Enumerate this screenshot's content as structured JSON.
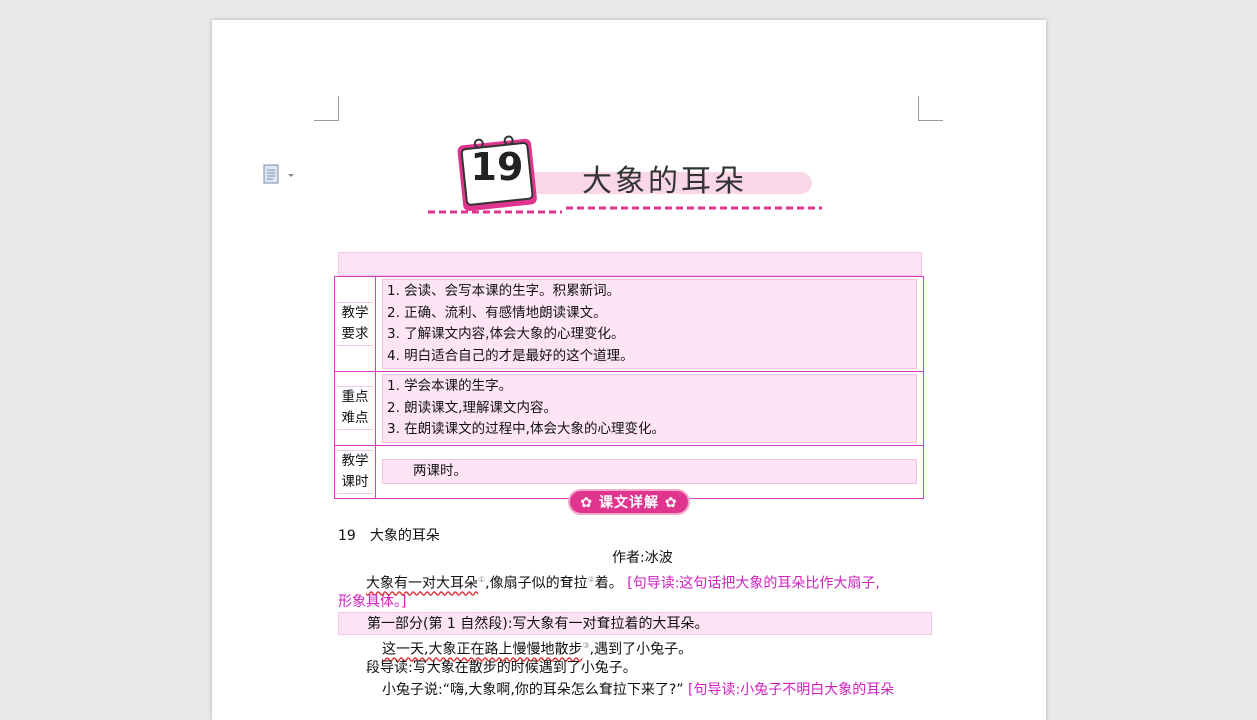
{
  "lesson": {
    "number": "19",
    "title": "大象的耳朵"
  },
  "requirements_table": {
    "rows": [
      {
        "label": "教学要求",
        "items": [
          "1. 会读、会写本课的生字。积累新词。",
          "2. 正确、流利、有感情地朗读课文。",
          "3. 了解课文内容,体会大象的心理变化。",
          "4. 明白适合自己的才是最好的这个道理。"
        ]
      },
      {
        "label": "重点难点",
        "items": [
          "1. 学会本课的生字。",
          "2. 朗读课文,理解课文内容。",
          "3. 在朗读课文的过程中,体会大象的心理变化。"
        ]
      },
      {
        "label": "教学课时",
        "items": [
          "两课时。"
        ]
      }
    ]
  },
  "section_badge": "✿ 课文详解 ✿",
  "text": {
    "heading": "19　大象的耳朵",
    "author": "作者:冰波",
    "p1_main": "大象有一对大耳朵",
    "p1_mid": ",像扇子似的耷拉",
    "p1_end": "着。",
    "p1_guide_a": "[句导读:这句话把大象的耳朵比作大扇子,",
    "p1_guide_b": "形象具体。]",
    "part1": "第一部分(第 1 自然段):写大象有一对耷拉着的大耳朵。",
    "p2_main": "这一天,大象正在路上慢慢地散步",
    "p2_end": ",遇到了小兔子。",
    "p2_guide": "段导读:写大象在散步的时候遇到了小兔子。",
    "p3_main": "小兔子说:“嗨,大象啊,你的耳朵怎么耷拉下来了?”",
    "p3_guide": "[句导读:小兔子不明白大象的耳朵"
  },
  "colors": {
    "accent_pink": "#d020c0",
    "table_border": "#d23cc8",
    "badge": "#e0358f"
  }
}
